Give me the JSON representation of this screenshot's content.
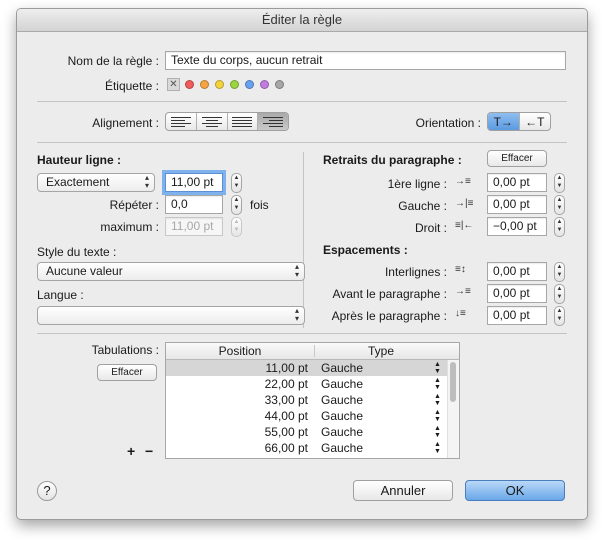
{
  "window": {
    "title": "Éditer la règle"
  },
  "rule_name": {
    "label": "Nom de la règle :",
    "value": "Texte du corps, aucun retrait"
  },
  "tag": {
    "label": "Étiquette :",
    "none_symbol": "✕",
    "colors": [
      "#f05b5b",
      "#f5a443",
      "#f2d23d",
      "#9bd43e",
      "#6aa0f0",
      "#c37be0",
      "#a7a7a7"
    ]
  },
  "alignment": {
    "label": "Alignement :",
    "selected_index": 3
  },
  "orientation": {
    "label": "Orientation :",
    "ltr": "T→",
    "rtl": "←T",
    "selected_index": 0
  },
  "line_height": {
    "heading": "Hauteur ligne :",
    "mode": "Exactement",
    "value": "11,00 pt",
    "repeat_label": "Répéter :",
    "repeat_value": "0,0",
    "repeat_unit": "fois",
    "max_label": "maximum :",
    "max_value": "11,00 pt"
  },
  "text_style": {
    "label": "Style du texte :",
    "value": "Aucune valeur"
  },
  "language": {
    "label": "Langue :",
    "value": ""
  },
  "indents": {
    "heading": "Retraits du paragraphe :",
    "clear": "Effacer",
    "first_label": "1ère ligne :",
    "first_value": "0,00 pt",
    "left_label": "Gauche :",
    "left_value": "0,00 pt",
    "right_label": "Droit :",
    "right_value": "−0,00 pt"
  },
  "spacing": {
    "heading": "Espacements :",
    "line_label": "Interlignes :",
    "line_value": "0,00 pt",
    "before_label": "Avant le paragraphe :",
    "before_value": "0,00 pt",
    "after_label": "Après le paragraphe :",
    "after_value": "0,00 pt"
  },
  "tabs": {
    "label": "Tabulations :",
    "clear": "Effacer",
    "col_position": "Position",
    "col_type": "Type",
    "rows": [
      {
        "position": "11,00 pt",
        "type": "Gauche"
      },
      {
        "position": "22,00 pt",
        "type": "Gauche"
      },
      {
        "position": "33,00 pt",
        "type": "Gauche"
      },
      {
        "position": "44,00 pt",
        "type": "Gauche"
      },
      {
        "position": "55,00 pt",
        "type": "Gauche"
      },
      {
        "position": "66,00 pt",
        "type": "Gauche"
      }
    ],
    "add": "+",
    "remove": "−"
  },
  "footer": {
    "help": "?",
    "cancel": "Annuler",
    "ok": "OK"
  }
}
